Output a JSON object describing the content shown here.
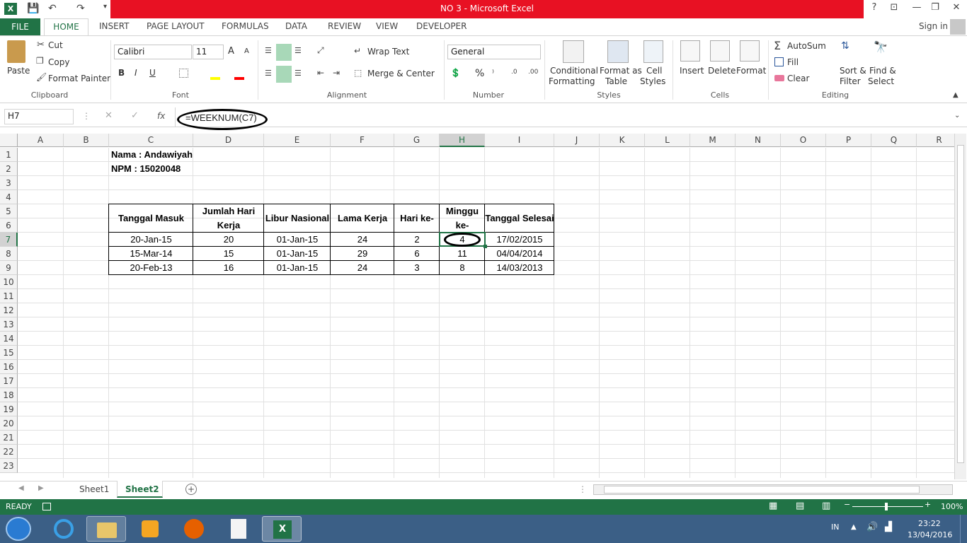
{
  "window": {
    "title": "NO 3 -  Microsoft Excel"
  },
  "title_controls": {
    "help": "?",
    "restore_ribbon": "⊡",
    "minimize": "—",
    "maximize": "❐",
    "close": "✕"
  },
  "qat": {
    "save": "💾",
    "undo": "↶",
    "redo": "↷",
    "more": "▾"
  },
  "tabs": {
    "file": "FILE",
    "home": "HOME",
    "insert": "INSERT",
    "page_layout": "PAGE LAYOUT",
    "formulas": "FORMULAS",
    "data": "DATA",
    "review": "REVIEW",
    "view": "VIEW",
    "developer": "DEVELOPER",
    "sign_in": "Sign in"
  },
  "ribbon": {
    "clipboard": {
      "paste": "Paste",
      "cut": "Cut",
      "copy": "Copy",
      "format_painter": "Format Painter",
      "label": "Clipboard"
    },
    "font": {
      "name": "Calibri",
      "size": "11",
      "bold": "B",
      "italic": "I",
      "underline": "U",
      "grow": "A",
      "shrink": "A",
      "label": "Font"
    },
    "alignment": {
      "wrap_text": "Wrap Text",
      "merge_center": "Merge & Center",
      "label": "Alignment"
    },
    "number": {
      "format": "General",
      "percent": "%",
      "comma": "⁾",
      "label": "Number"
    },
    "styles": {
      "conditional": "Conditional",
      "conditional2": "Formatting",
      "format_as": "Format as",
      "format_as2": "Table",
      "cell": "Cell",
      "cell2": "Styles",
      "label": "Styles"
    },
    "cells": {
      "insert": "Insert",
      "delete": "Delete",
      "format": "Format",
      "label": "Cells"
    },
    "editing": {
      "autosum": "AutoSum",
      "fill": "Fill",
      "clear": "Clear",
      "sort": "Sort &",
      "sort2": "Filter",
      "find": "Find &",
      "find2": "Select",
      "label": "Editing"
    }
  },
  "formula_bar": {
    "name_box": "H7",
    "formula": "=WEEKNUM(C7)",
    "fx": "fx"
  },
  "columns": [
    "A",
    "B",
    "C",
    "D",
    "E",
    "F",
    "G",
    "H",
    "I",
    "J",
    "K",
    "L",
    "M",
    "N",
    "O",
    "P",
    "Q",
    "R"
  ],
  "rows": [
    "1",
    "2",
    "3",
    "4",
    "5",
    "6",
    "7",
    "8",
    "9",
    "10",
    "11",
    "12",
    "13",
    "14",
    "15",
    "16",
    "17",
    "18",
    "19",
    "20",
    "21",
    "22",
    "23"
  ],
  "sheet": {
    "nama": "Nama : Andawiyah",
    "npm": "NPM  : 15020048",
    "headers": {
      "c": "Tanggal Masuk",
      "d1": "Jumlah  Hari",
      "d2": "Kerja",
      "e": "Libur Nasional",
      "f": "Lama Kerja",
      "g": "Hari ke-",
      "h1": "Minggu",
      "h2": "ke-",
      "i": "Tanggal Selesai"
    },
    "data": [
      [
        "20-Jan-15",
        "20",
        "01-Jan-15",
        "24",
        "2",
        "4",
        "17/02/2015"
      ],
      [
        "15-Mar-14",
        "15",
        "01-Jan-15",
        "29",
        "6",
        "11",
        "04/04/2014"
      ],
      [
        "20-Feb-13",
        "16",
        "01-Jan-15",
        "24",
        "3",
        "8",
        "14/03/2013"
      ]
    ]
  },
  "sheet_tabs": {
    "sheet1": "Sheet1",
    "sheet2": "Sheet2"
  },
  "status": {
    "ready": "READY",
    "zoom": "100%"
  },
  "taskbar": {
    "lang": "IN",
    "time": "23:22",
    "date": "13/04/2016"
  }
}
